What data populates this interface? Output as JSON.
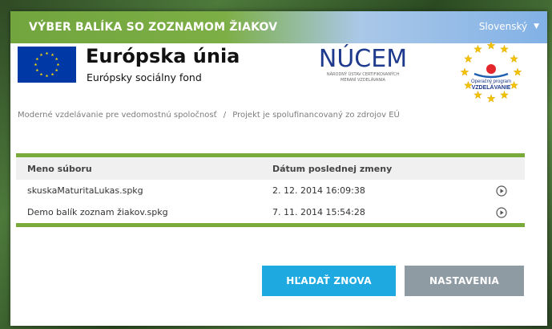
{
  "dialog": {
    "title": "VÝBER BALÍKA SO ZOZNAMOM ŽIAKOV",
    "language": "Slovenský"
  },
  "logos": {
    "eu_title": "Európska únia",
    "eu_subtitle": "Európsky sociálny fond",
    "nucem_name": "NÚCEM",
    "nucem_line1": "NÁRODNÝ ÚSTAV CERTIFIKOVANÝCH",
    "nucem_line2": "MERANÍ VZDELÁVANIA",
    "op_line1": "Operačný program",
    "op_line2": "VZDELÁVANIE"
  },
  "breadcrumb": {
    "item1": "Moderné vzdelávanie pre vedomostnú spoločnosť",
    "separator": "/",
    "item2": "Projekt je spolufinancovaný zo zdrojov EÚ"
  },
  "table": {
    "headers": {
      "name": "Meno súboru",
      "date": "Dátum poslednej zmeny"
    },
    "rows": [
      {
        "name": "skuskaMaturitaLukas.spkg",
        "date": "2. 12. 2014 16:09:38"
      },
      {
        "name": "Demo balík zoznam žiakov.spkg",
        "date": "7. 11. 2014 15:54:28"
      }
    ]
  },
  "buttons": {
    "search_again": "HĽADAŤ ZNOVA",
    "settings": "NASTAVENIA"
  },
  "colors": {
    "accent_green": "#7aab3a",
    "primary_button": "#1ea9e1",
    "secondary_button": "#8f9ba3",
    "eu_blue": "#0038a6",
    "eu_yellow": "#ffdd00"
  },
  "icons": {
    "language_caret": "chevron-down-icon",
    "row_action": "play-circle-icon"
  }
}
